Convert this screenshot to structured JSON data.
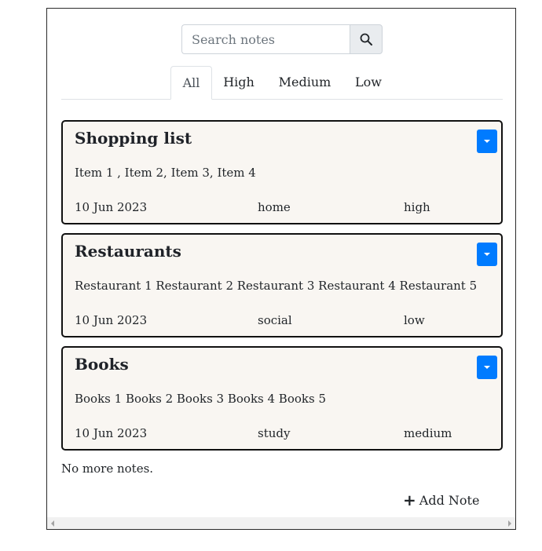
{
  "search": {
    "placeholder": "Search notes",
    "value": ""
  },
  "tabs": [
    {
      "label": "All",
      "active": true
    },
    {
      "label": "High",
      "active": false
    },
    {
      "label": "Medium",
      "active": false
    },
    {
      "label": "Low",
      "active": false
    }
  ],
  "notes": [
    {
      "title": "Shopping list",
      "body": "Item 1 , Item 2, Item 3, Item 4",
      "date": "10 Jun 2023",
      "category": "home",
      "priority": "high"
    },
    {
      "title": "Restaurants",
      "body": "Restaurant 1 Restaurant 2 Restaurant 3 Restaurant 4 Restaurant 5",
      "date": "10 Jun 2023",
      "category": "social",
      "priority": "low"
    },
    {
      "title": "Books",
      "body": "Books 1 Books 2 Books 3 Books 4 Books 5",
      "date": "10 Jun 2023",
      "category": "study",
      "priority": "medium"
    }
  ],
  "footer": {
    "no_more": "No more notes.",
    "add_note_label": "Add Note"
  },
  "colors": {
    "accent": "#007bff",
    "card_bg": "#f9f6f2",
    "card_border": "#111111"
  },
  "icons": {
    "search": "search-icon",
    "menu": "caret-down-icon",
    "add": "plus-icon"
  }
}
